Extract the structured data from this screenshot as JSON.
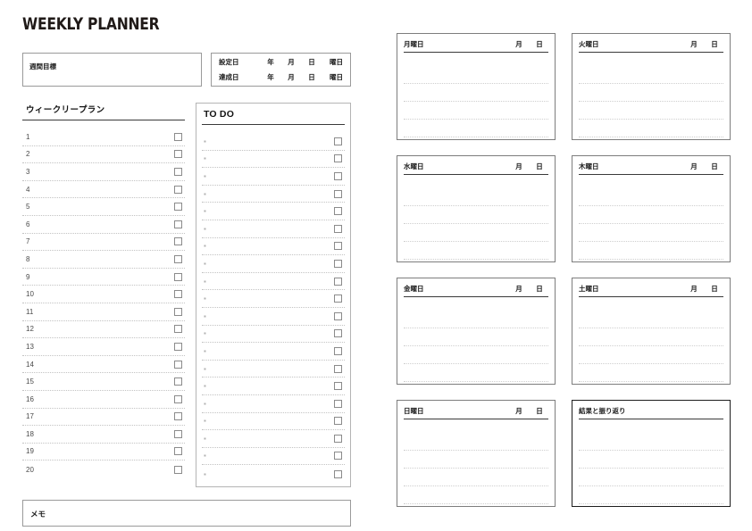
{
  "page": {
    "title": "WEEKLY PLANNER"
  },
  "goal": {
    "label": "週間目標"
  },
  "dates": {
    "rows": [
      {
        "name": "設定日",
        "year": "年",
        "month": "月",
        "day": "日",
        "weekday": "曜日"
      },
      {
        "name": "達成日",
        "year": "年",
        "month": "月",
        "day": "日",
        "weekday": "曜日"
      }
    ]
  },
  "weekly_plan": {
    "heading": "ウィークリープラン",
    "rows": [
      {
        "num": "1"
      },
      {
        "num": "2"
      },
      {
        "num": "3"
      },
      {
        "num": "4"
      },
      {
        "num": "5"
      },
      {
        "num": "6"
      },
      {
        "num": "7"
      },
      {
        "num": "8"
      },
      {
        "num": "9"
      },
      {
        "num": "10"
      },
      {
        "num": "11"
      },
      {
        "num": "12"
      },
      {
        "num": "13"
      },
      {
        "num": "14"
      },
      {
        "num": "15"
      },
      {
        "num": "16"
      },
      {
        "num": "17"
      },
      {
        "num": "18"
      },
      {
        "num": "19"
      },
      {
        "num": "20"
      }
    ]
  },
  "todo": {
    "heading": "TO DO",
    "bullet": "▪",
    "row_count": 20
  },
  "memo": {
    "label": "メモ"
  },
  "days": [
    {
      "name": "月曜日",
      "month": "月",
      "day": "日",
      "lines": 4,
      "emphasis": false
    },
    {
      "name": "火曜日",
      "month": "月",
      "day": "日",
      "lines": 4,
      "emphasis": false
    },
    {
      "name": "水曜日",
      "month": "月",
      "day": "日",
      "lines": 4,
      "emphasis": false
    },
    {
      "name": "木曜日",
      "month": "月",
      "day": "日",
      "lines": 4,
      "emphasis": false
    },
    {
      "name": "金曜日",
      "month": "月",
      "day": "日",
      "lines": 4,
      "emphasis": false
    },
    {
      "name": "土曜日",
      "month": "月",
      "day": "日",
      "lines": 4,
      "emphasis": false
    },
    {
      "name": "日曜日",
      "month": "月",
      "day": "日",
      "lines": 4,
      "emphasis": false
    },
    {
      "name": "結果と振り返り",
      "month": "",
      "day": "",
      "lines": 4,
      "emphasis": true
    }
  ],
  "colors": {
    "text": "#1a1a1a",
    "box_border": "#9a9a9a",
    "day_border": "#7d7d7d",
    "emphasis_border": "#1d1d1d",
    "rule": "#3a3a3a",
    "dotted": "#c3c3c3",
    "checkbox_border": "#8b8b8b",
    "background": "#ffffff"
  }
}
